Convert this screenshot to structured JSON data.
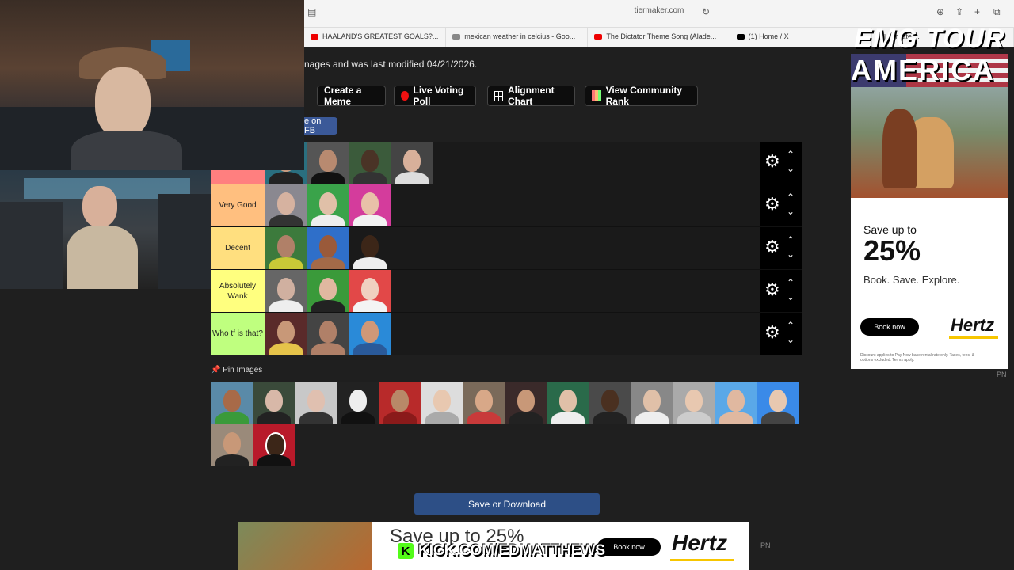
{
  "browser": {
    "url": "tiermaker.com",
    "tabs": [
      {
        "label": "HAALAND'S GREATEST GOALS?...",
        "fav": "#e00"
      },
      {
        "label": "mexican weather in celcius - Goo...",
        "fav": "#888"
      },
      {
        "label": "The Dictator Theme Song (Alade...",
        "fav": "#e00"
      },
      {
        "label": "(1) Home / X",
        "fav": "#000"
      },
      {
        "label": "Create ...",
        "fav": "#aaa"
      }
    ]
  },
  "page": {
    "info_text": "nages and was last modified 04/21/2026.",
    "buttons": {
      "create_meme": "Create a Meme",
      "live_voting": "Live Voting Poll",
      "alignment_chart": "Alignment Chart",
      "community_rank": "View Community Rank",
      "share_fb": "e on FB"
    },
    "tiers": [
      {
        "label": "",
        "color": "#ff7f7f"
      },
      {
        "label": "Very Good",
        "color": "#ffbf7f"
      },
      {
        "label": "Decent",
        "color": "#ffdf7f"
      },
      {
        "label": "Absolutely Wank",
        "color": "#ffff7f"
      },
      {
        "label": "Who tf is that?",
        "color": "#bfff7f"
      }
    ],
    "pin_label": "Pin Images",
    "save_button": "Save or Download"
  },
  "ad_right": {
    "small": "Save up to",
    "big": "25%",
    "tagline": "Book. Save. Explore.",
    "book_button": "Book now",
    "logo": "Hertz",
    "fine_print": "Discount applies to Pay Now base rental rate only. Taxes, fees, & options excluded. Terms apply.",
    "pn": "PN"
  },
  "overlay": {
    "tour_title": "EMG TOUR",
    "tour_sub": "AMERICA"
  },
  "bottom_ad": {
    "text": "Save up to 25%",
    "book_button": "Book now",
    "logo": "Hertz",
    "pn": "PN"
  },
  "stream": {
    "kick_logo": "K",
    "kick_url": "KICK.COM/EDMATTHEWS"
  },
  "icons": {
    "gear": "⚙",
    "up": "⌃",
    "down": "⌄"
  }
}
